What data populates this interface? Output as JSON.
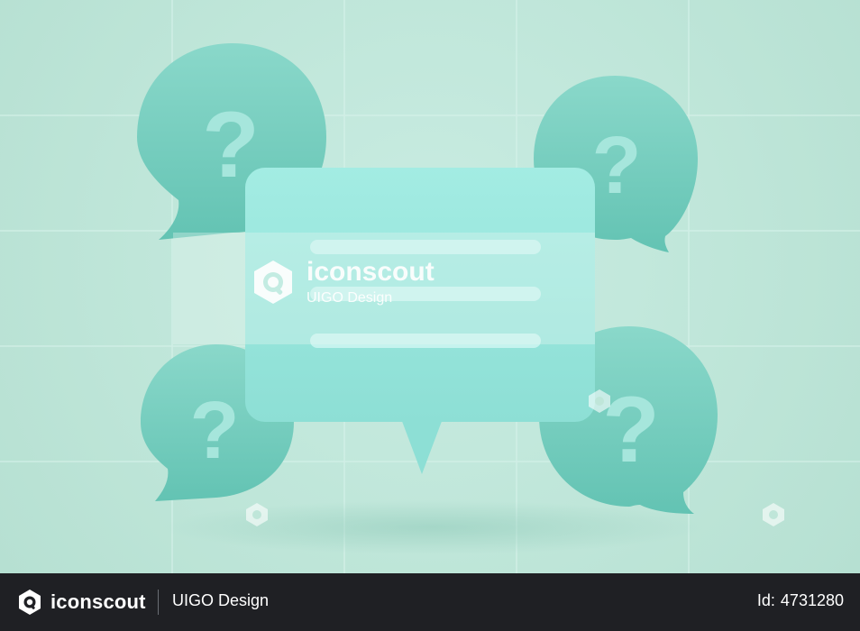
{
  "watermark": {
    "brand": "iconscout",
    "author": "UIGO Design"
  },
  "footer": {
    "brand": "iconscout",
    "author": "UIGO Design",
    "id_label": "Id:",
    "id_value": "4731280"
  },
  "colors": {
    "background": "#c3e9dc",
    "bubble": "#7fd0c2",
    "bubble_dark": "#5fbfb0",
    "card": "#94e3da",
    "footer": "#1f2024"
  }
}
